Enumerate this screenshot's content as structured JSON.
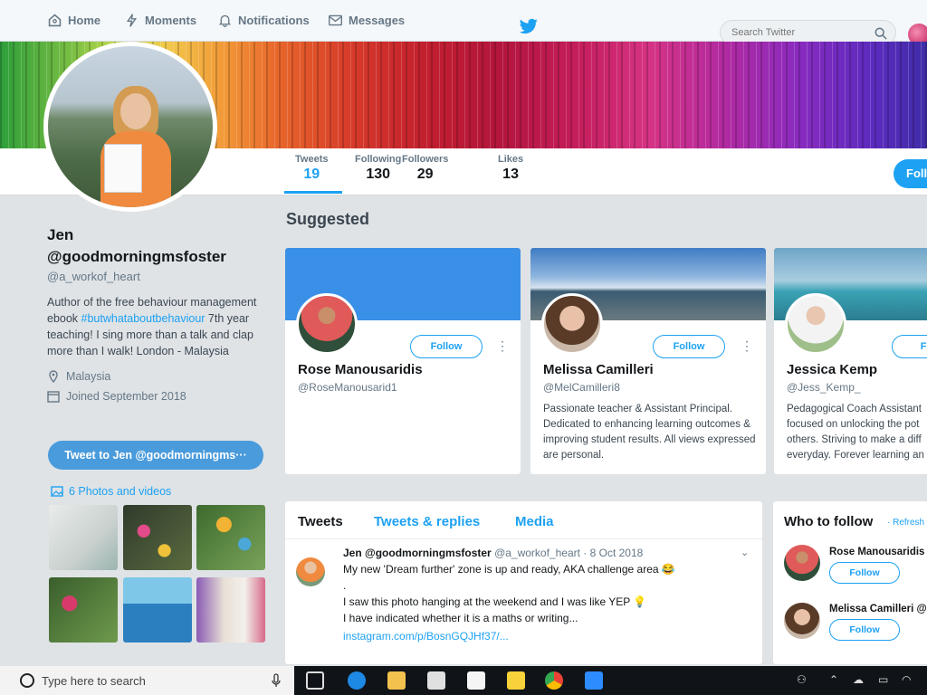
{
  "nav": {
    "home": "Home",
    "moments": "Moments",
    "notifications": "Notifications",
    "messages": "Messages",
    "search_placeholder": "Search Twitter"
  },
  "stats": [
    {
      "label": "Tweets",
      "value": "19"
    },
    {
      "label": "Following",
      "value": "130"
    },
    {
      "label": "Followers",
      "value": "29"
    },
    {
      "label": "Likes",
      "value": "13"
    }
  ],
  "follow_button": "Foll",
  "profile": {
    "name_line1": "Jen",
    "name_line2": "@goodmorningmsfoster",
    "handle": "@a_workof_heart",
    "bio_before": "Author of the free behaviour management ebook ",
    "bio_tag": "#butwhataboutbehaviour",
    "bio_after": " 7th year teaching! I sing more than a talk and clap more than I walk! London - Malaysia",
    "location": "Malaysia",
    "joined": "Joined September 2018",
    "tweet_to": "Tweet to Jen @goodmorningms···",
    "photos_link": "6 Photos and videos"
  },
  "suggested": {
    "title": "Suggested",
    "cards": [
      {
        "name": "Rose Manousaridis",
        "handle": "@RoseManousarid1",
        "bio": "",
        "follow": "Follow"
      },
      {
        "name": "Melissa Camilleri",
        "handle": "@MelCamilleri8",
        "bio": "Passionate teacher & Assistant Principal. Dedicated to enhancing learning outcomes & improving student results. All views expressed are personal.",
        "follow": "Follow"
      },
      {
        "name": "Jessica Kemp",
        "handle": "@Jess_Kemp_",
        "bio": "Pedagogical Coach Assistant focused on unlocking the pot others. Striving to make a diff everyday. Forever learning an",
        "follow": "Fol"
      }
    ]
  },
  "tweets": {
    "tabs": [
      "Tweets",
      "Tweets & replies",
      "Media"
    ],
    "author": "Jen @goodmorningmsfoster",
    "author_handle_date": "@a_workof_heart · 8 Oct 2018",
    "lines": [
      "My new 'Dream further' zone is up and ready, AKA challenge area 😂",
      ".",
      "I saw this photo hanging at the weekend and I was like YEP 💡",
      "I have indicated whether it is a maths or writing..."
    ],
    "link": "instagram.com/p/BosnGQJHf37/..."
  },
  "who_to_follow": {
    "title": "Who to follow",
    "refresh": "· Refresh ·",
    "people": [
      {
        "name": "Rose Manousaridis",
        "follow": "Follow"
      },
      {
        "name": "Melissa Camilleri @",
        "follow": "Follow"
      }
    ]
  },
  "taskbar": {
    "search_text": "Type here to search"
  },
  "colors": {
    "accent": "#1da1f2",
    "secondary_text": "#657786"
  }
}
